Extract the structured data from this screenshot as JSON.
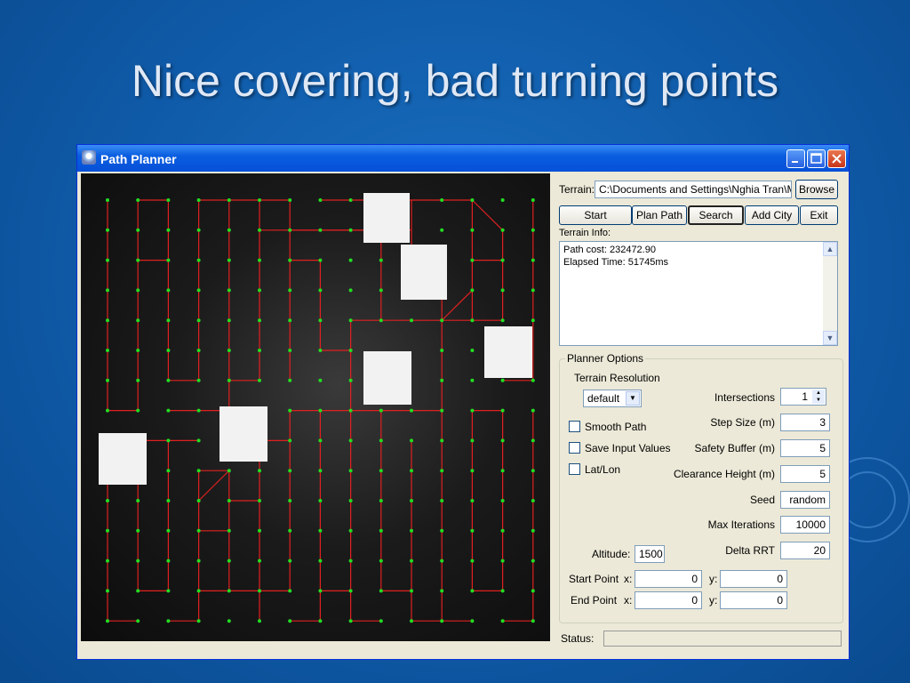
{
  "slide": {
    "title": "Nice covering, bad turning points"
  },
  "window": {
    "title": "Path Planner",
    "icon": "app-icon",
    "controls": [
      "minimize-icon",
      "maximize-icon",
      "close-icon"
    ]
  },
  "map": {
    "background": "#111111",
    "path_color": "#e02020",
    "node_color": "#22dd22",
    "obstacle_color": "#f2f2f2",
    "grid_cols": 15,
    "grid_rows": 15
  },
  "panel": {
    "terrain_label": "Terrain:",
    "terrain_value": "C:\\Documents and Settings\\Nghia Tran\\My",
    "browse": "Browse",
    "buttons": [
      "Start",
      "Plan Path",
      "Search",
      "Add City",
      "Exit"
    ],
    "selected_button": "Search",
    "terrain_info_label": "Terrain Info:",
    "info_lines": [
      "Path cost: 232472.90",
      "Elapsed Time: 51745ms"
    ],
    "planner_options_label": "Planner Options",
    "terrain_resolution_label": "Terrain Resolution",
    "resolution_value": "default",
    "checkboxes": [
      "Smooth Path",
      "Save Input Values",
      "Lat/Lon"
    ],
    "intersections_label": "Intersections",
    "intersections_value": "1",
    "step_size_label": "Step Size (m)",
    "step_size_value": "3",
    "safety_buffer_label": "Safety Buffer (m)",
    "safety_buffer_value": "5",
    "clearance_label": "Clearance Height (m)",
    "clearance_value": "5",
    "seed_label": "Seed",
    "seed_value": "random",
    "max_iter_label": "Max Iterations",
    "max_iter_value": "10000",
    "delta_label": "Delta RRT",
    "delta_value": "20",
    "altitude_label": "Altitude:",
    "altitude_value": "1500",
    "start_label": "Start Point",
    "end_label": "End Point",
    "x_label": "x:",
    "y_label": "y:",
    "start_x": "0",
    "start_y": "0",
    "end_x": "0",
    "end_y": "0",
    "status_label": "Status:"
  }
}
